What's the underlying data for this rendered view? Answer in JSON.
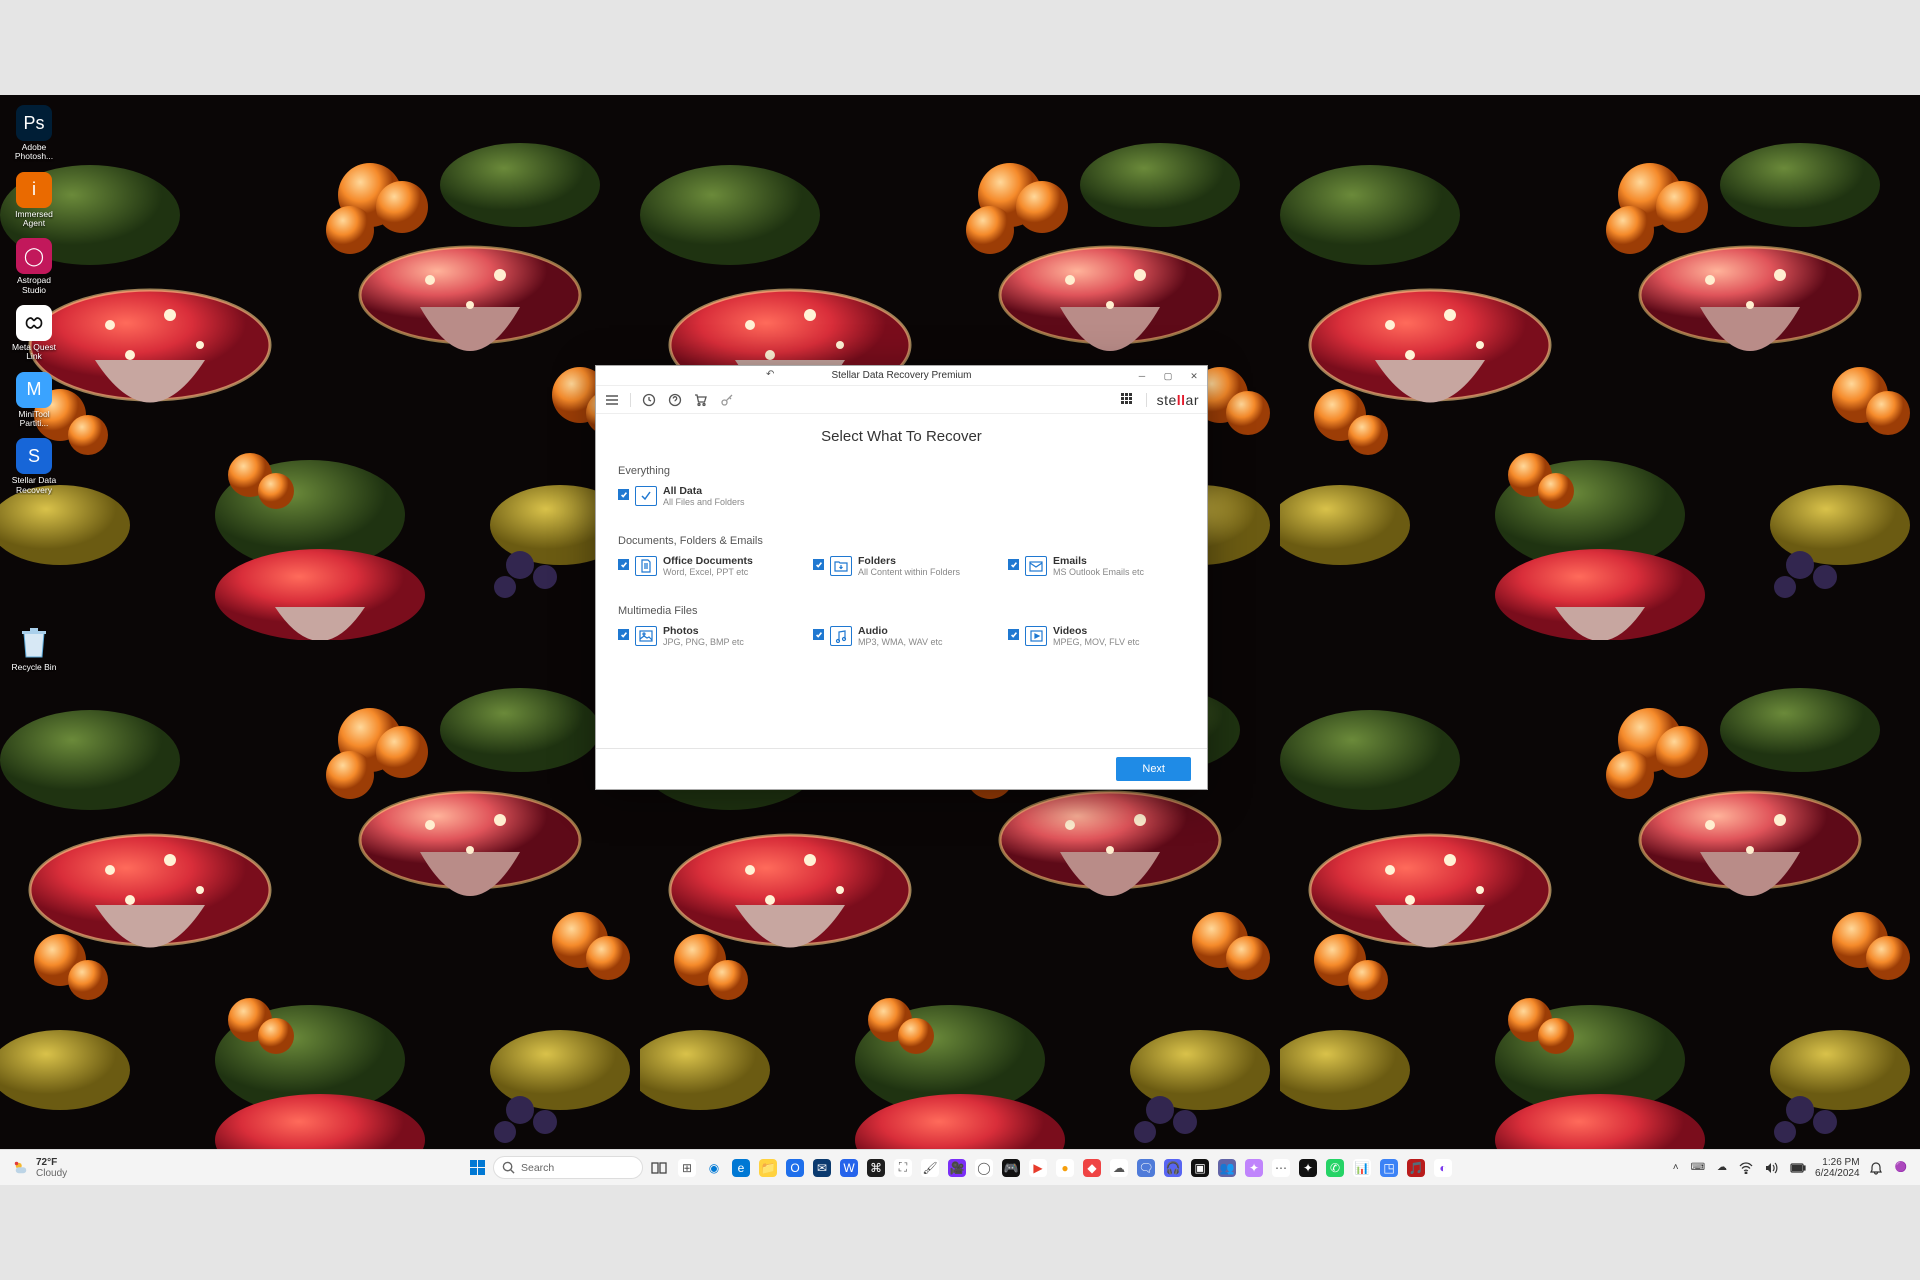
{
  "desktop_icons": [
    {
      "label": "Adobe Photosh...",
      "cls": "c0"
    },
    {
      "label": "Immersed Agent",
      "cls": "c1"
    },
    {
      "label": "Astropad Studio",
      "cls": "c2"
    },
    {
      "label": "Meta Quest Link",
      "cls": "c3"
    },
    {
      "label": "MiniTool Partiti...",
      "cls": "c4"
    },
    {
      "label": "Stellar Data Recovery",
      "cls": "c5"
    }
  ],
  "recycle_label": "Recycle Bin",
  "app": {
    "title": "Stellar Data Recovery Premium",
    "brand_prefix": "ste",
    "brand_mid": "ll",
    "brand_suffix": "ar",
    "header": "Select What To Recover",
    "section_everything": "Everything",
    "all_data": {
      "title": "All Data",
      "sub": "All Files and Folders"
    },
    "section_docs": "Documents, Folders & Emails",
    "docs": [
      {
        "title": "Office Documents",
        "sub": "Word, Excel, PPT etc"
      },
      {
        "title": "Folders",
        "sub": "All Content within Folders"
      },
      {
        "title": "Emails",
        "sub": "MS Outlook Emails etc"
      }
    ],
    "section_mm": "Multimedia Files",
    "mm": [
      {
        "title": "Photos",
        "sub": "JPG, PNG, BMP etc"
      },
      {
        "title": "Audio",
        "sub": "MP3, WMA, WAV etc"
      },
      {
        "title": "Videos",
        "sub": "MPEG, MOV, FLV etc"
      }
    ],
    "next_label": "Next"
  },
  "taskbar": {
    "weather_temp": "72°F",
    "weather_desc": "Cloudy",
    "search_placeholder": "Search",
    "time": "1:26 PM",
    "date": "6/24/2024",
    "pinned": [
      {
        "bg": "#fff",
        "fg": "#555",
        "ch": "⊞"
      },
      {
        "bg": "transparent",
        "fg": "#0078d4",
        "ch": "◉"
      },
      {
        "bg": "#0078d4",
        "fg": "#fff",
        "ch": "e"
      },
      {
        "bg": "#ffd23f",
        "fg": "#333",
        "ch": "📁"
      },
      {
        "bg": "#1f6feb",
        "fg": "#fff",
        "ch": "O"
      },
      {
        "bg": "#0b3a6f",
        "fg": "#fff",
        "ch": "✉"
      },
      {
        "bg": "#2563eb",
        "fg": "#fff",
        "ch": "W"
      },
      {
        "bg": "#1e1e1e",
        "fg": "#fff",
        "ch": "⌘"
      },
      {
        "bg": "#fff",
        "fg": "#555",
        "ch": "⛶"
      },
      {
        "bg": "#fff",
        "fg": "#444",
        "ch": "🖌"
      },
      {
        "bg": "#7b2ff7",
        "fg": "#fff",
        "ch": "🎥"
      },
      {
        "bg": "#fff",
        "fg": "#555",
        "ch": "◯"
      },
      {
        "bg": "#111",
        "fg": "#fff",
        "ch": "🎮"
      },
      {
        "bg": "#fff",
        "fg": "#e73b2b",
        "ch": "▶"
      },
      {
        "bg": "#fff",
        "fg": "#f59e0b",
        "ch": "●"
      },
      {
        "bg": "#ef4444",
        "fg": "#fff",
        "ch": "◆"
      },
      {
        "bg": "#fff",
        "fg": "#555",
        "ch": "☁"
      },
      {
        "bg": "#4f7bd9",
        "fg": "#fff",
        "ch": "🗨"
      },
      {
        "bg": "#5865f2",
        "fg": "#fff",
        "ch": "🎧"
      },
      {
        "bg": "#111",
        "fg": "#fff",
        "ch": "▣"
      },
      {
        "bg": "#6264a7",
        "fg": "#fff",
        "ch": "👥"
      },
      {
        "bg": "#c084fc",
        "fg": "#fff",
        "ch": "✦"
      },
      {
        "bg": "#fff",
        "fg": "#555",
        "ch": "⋯"
      },
      {
        "bg": "#111",
        "fg": "#fff",
        "ch": "✦"
      },
      {
        "bg": "#25d366",
        "fg": "#fff",
        "ch": "✆"
      },
      {
        "bg": "#fff",
        "fg": "#555",
        "ch": "📊"
      },
      {
        "bg": "#3b82f6",
        "fg": "#fff",
        "ch": "◳"
      },
      {
        "bg": "#b91c1c",
        "fg": "#fff",
        "ch": "🎵"
      },
      {
        "bg": "#fff",
        "fg": "#7c3aed",
        "ch": "◐"
      }
    ]
  }
}
